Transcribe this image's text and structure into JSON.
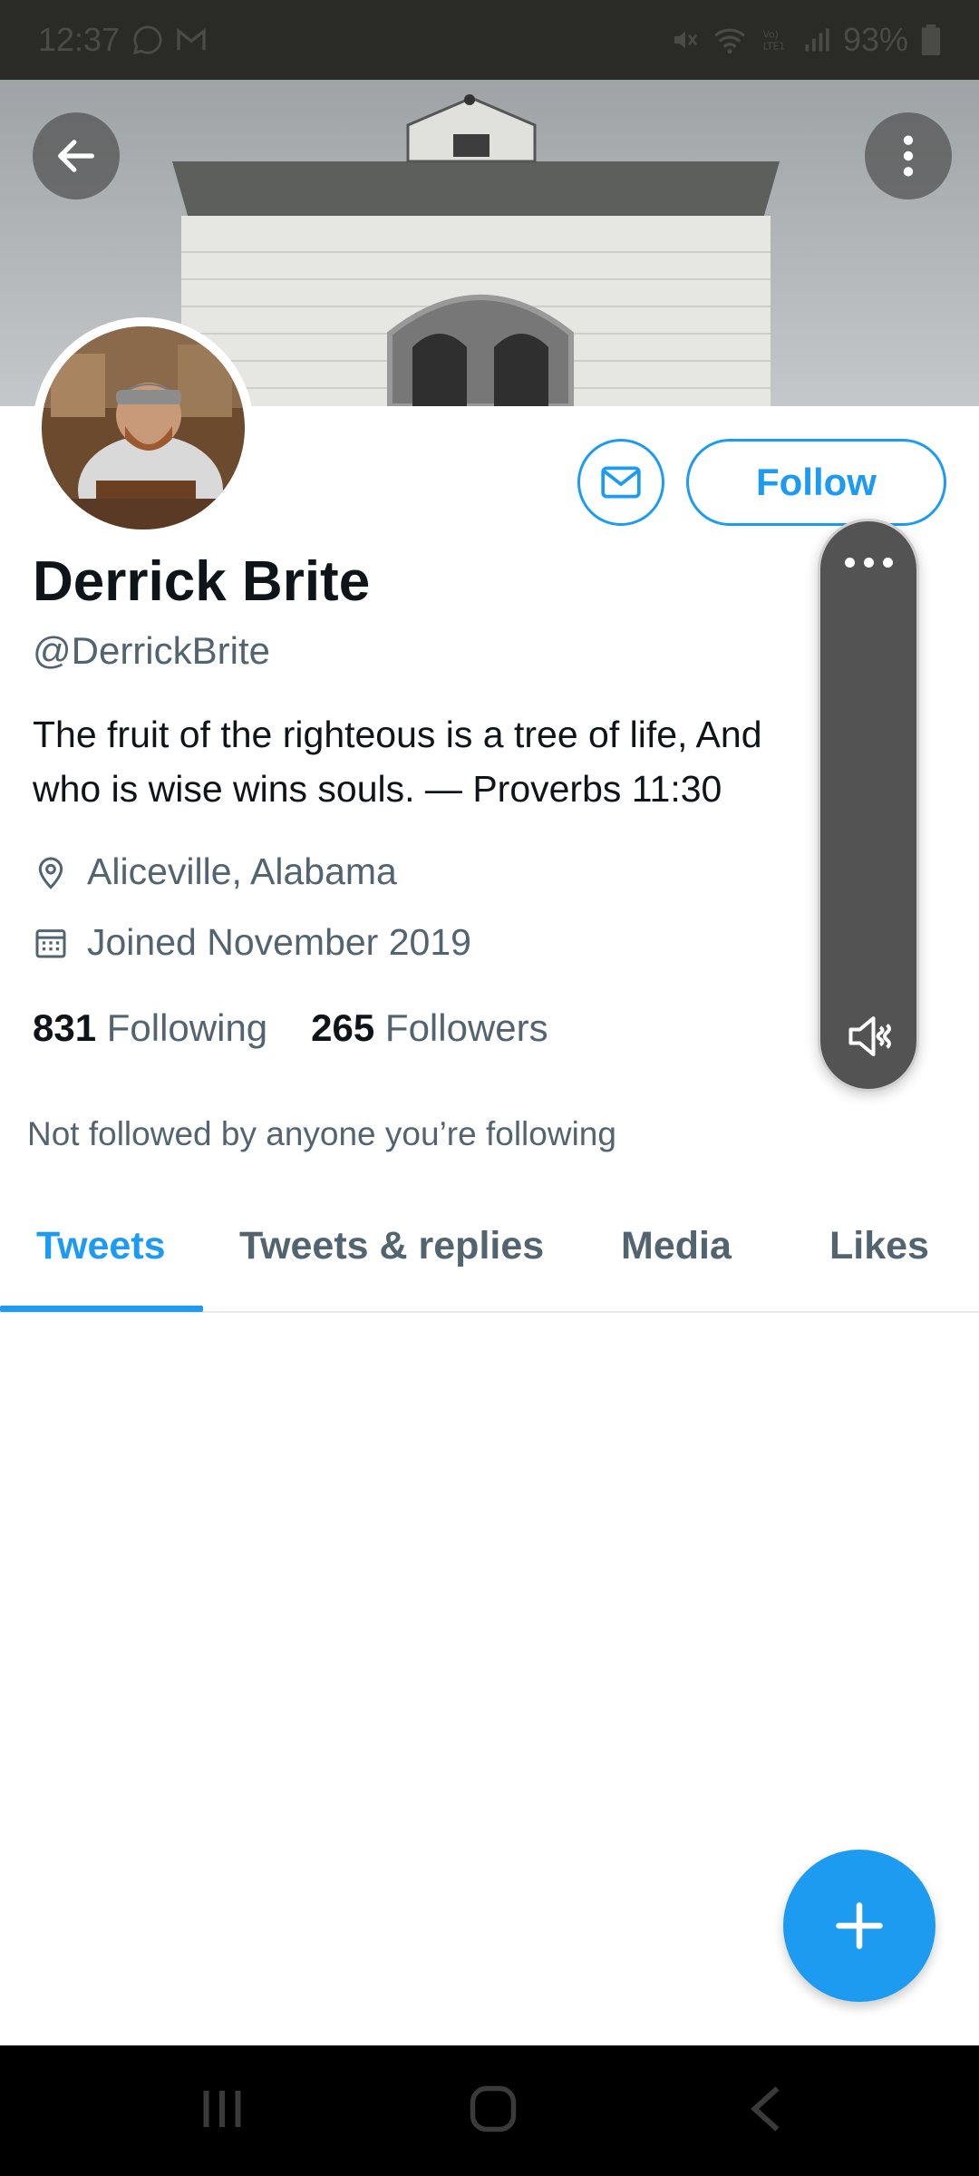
{
  "status": {
    "time": "12:37",
    "battery": "93%"
  },
  "profile": {
    "name": "Derrick Brite",
    "handle": "@DerrickBrite",
    "bio_line1": "The fruit of the righteous is a tree of life, And",
    "bio_line2": "who is wise wins souls. — Proverbs 11:30",
    "location": "Aliceville, Alabama",
    "joined": "Joined November 2019",
    "following_count": "831",
    "following_label": "Following",
    "followers_count": "265",
    "followers_label": "Followers",
    "not_followed": "Not followed by anyone you’re following"
  },
  "actions": {
    "follow_label": "Follow"
  },
  "tabs": [
    {
      "label": "Tweets",
      "active": true
    },
    {
      "label": "Tweets & replies",
      "active": false
    },
    {
      "label": "Media",
      "active": false
    },
    {
      "label": "Likes",
      "active": false
    }
  ],
  "colors": {
    "accent": "#1d9bf0",
    "text_primary": "#0f1419",
    "text_secondary": "#536471"
  },
  "icons": {
    "back": "arrow-left-icon",
    "more": "more-vertical-icon",
    "message": "envelope-icon",
    "location": "location-pin-icon",
    "calendar": "calendar-icon",
    "compose": "plus-icon",
    "mute": "volume-mute-icon"
  }
}
